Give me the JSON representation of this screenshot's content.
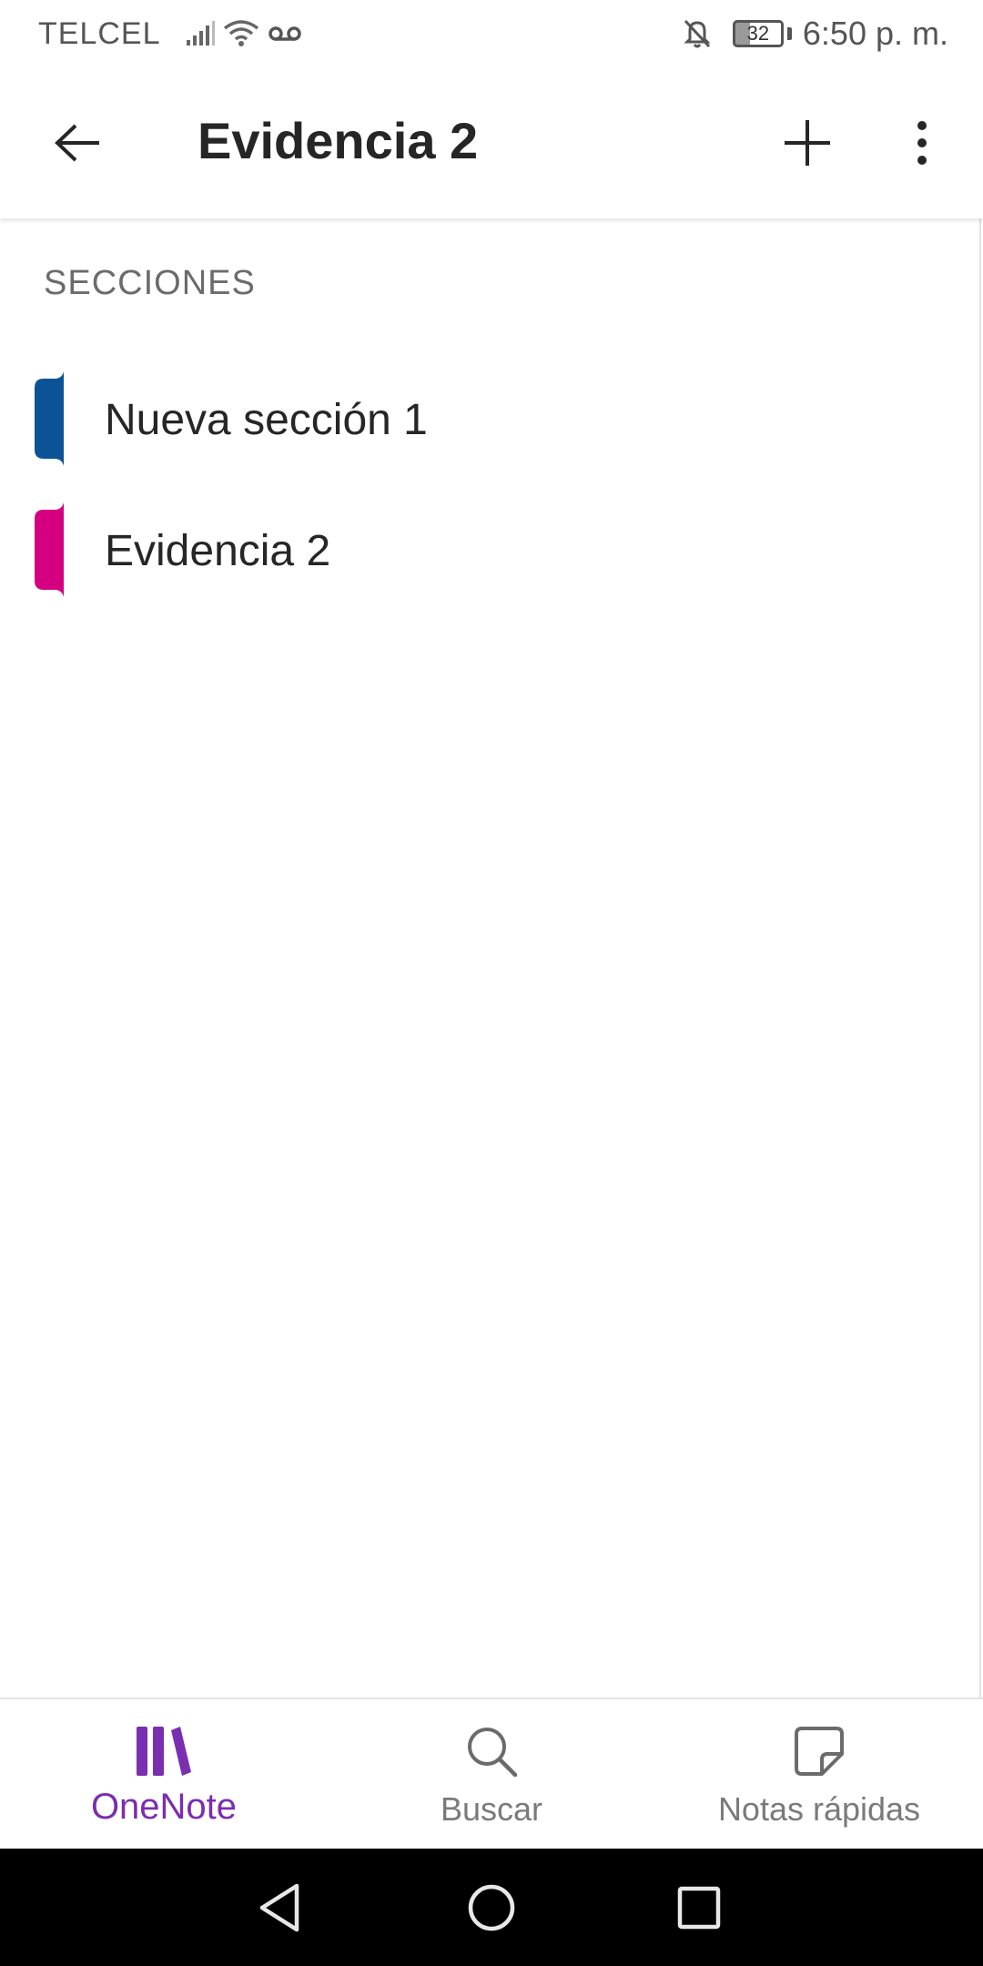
{
  "status_bar": {
    "carrier": "TELCEL",
    "battery_level": "32",
    "time": "6:50 p. m.",
    "icons": [
      "signal-icon",
      "wifi-icon",
      "voicemail-icon",
      "bell-off-icon",
      "battery-icon"
    ]
  },
  "app_bar": {
    "title": "Evidencia 2",
    "icons": [
      "back-arrow-icon",
      "plus-icon",
      "more-vertical-icon"
    ]
  },
  "sections": {
    "header": "SECCIONES",
    "items": [
      {
        "label": "Nueva sección 1",
        "color": "#0b5394"
      },
      {
        "label": "Evidencia 2",
        "color": "#d4007f"
      }
    ]
  },
  "bottom_nav": {
    "accent_color": "#7a2eb0",
    "items": [
      {
        "label": "OneNote",
        "icon": "onenote-notebooks-icon",
        "active": true
      },
      {
        "label": "Buscar",
        "icon": "search-icon",
        "active": false
      },
      {
        "label": "Notas rápidas",
        "icon": "sticky-note-icon",
        "active": false
      }
    ]
  },
  "system_nav": {
    "icons": [
      "back-triangle-icon",
      "home-circle-icon",
      "recents-square-icon"
    ]
  }
}
